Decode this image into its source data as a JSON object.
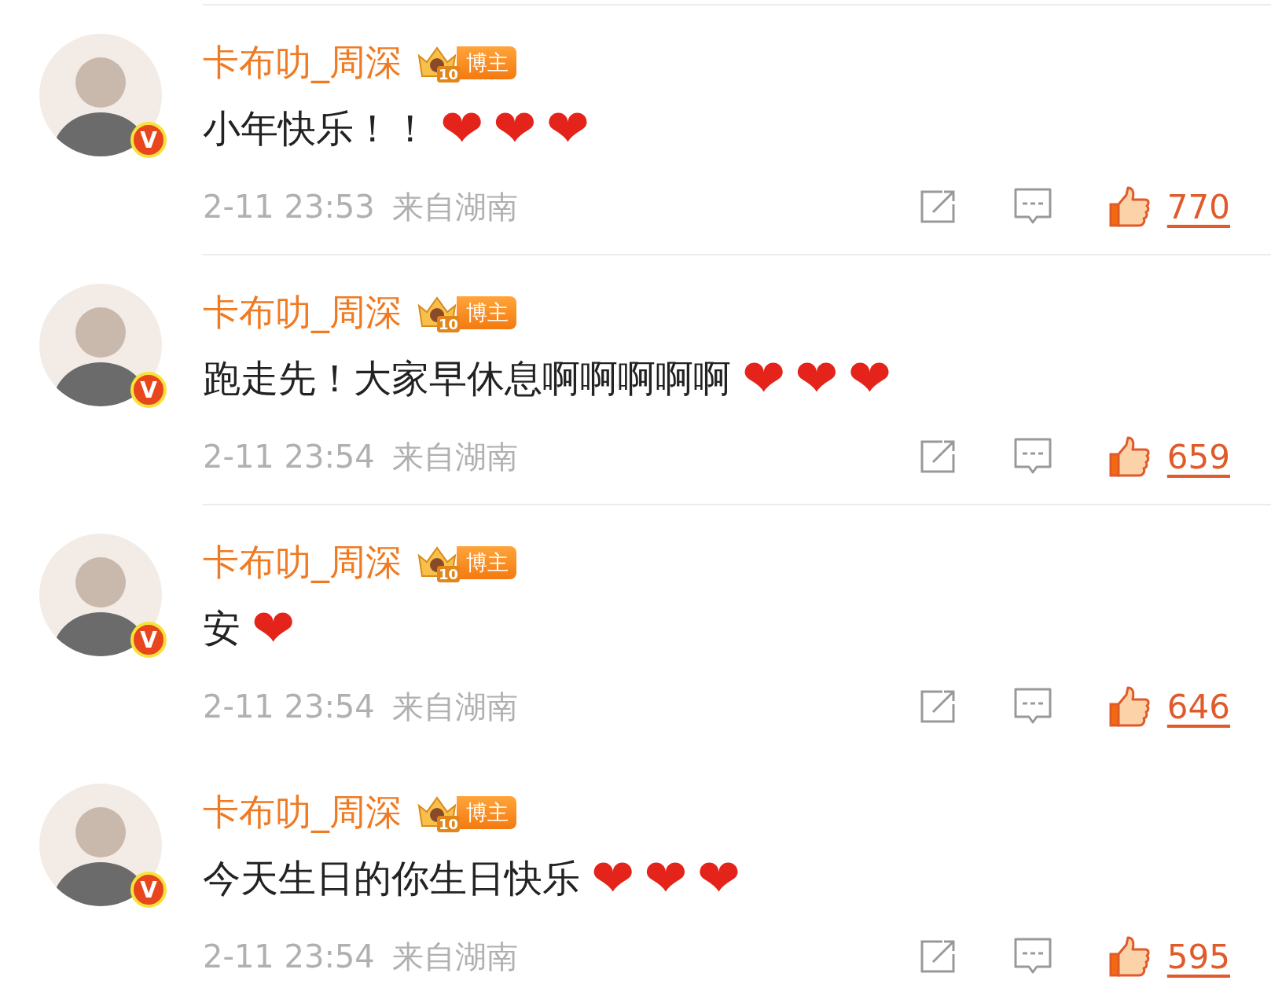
{
  "comments": [
    {
      "author": "卡布叻_周深",
      "badge": {
        "rank": "10",
        "label": "博主"
      },
      "verified_mark": "V",
      "text": "小年快乐！！",
      "emoji": [
        "❤",
        "❤",
        "❤"
      ],
      "time": "2-11 23:53",
      "location": "来自湖南",
      "liked": true,
      "likes": "770"
    },
    {
      "author": "卡布叻_周深",
      "badge": {
        "rank": "10",
        "label": "博主"
      },
      "verified_mark": "V",
      "text": "跑走先！大家早休息啊啊啊啊啊",
      "emoji": [
        "❤",
        "❤",
        "❤"
      ],
      "time": "2-11 23:54",
      "location": "来自湖南",
      "liked": true,
      "likes": "659"
    },
    {
      "author": "卡布叻_周深",
      "badge": {
        "rank": "10",
        "label": "博主"
      },
      "verified_mark": "V",
      "text": "安",
      "emoji": [
        "❤"
      ],
      "time": "2-11 23:54",
      "location": "来自湖南",
      "liked": true,
      "likes": "646"
    },
    {
      "author": "卡布叻_周深",
      "badge": {
        "rank": "10",
        "label": "博主"
      },
      "verified_mark": "V",
      "text": "今天生日的你生日快乐",
      "emoji": [
        "❤",
        "❤",
        "❤"
      ],
      "time": "2-11 23:54",
      "location": "来自湖南",
      "liked": true,
      "likes": "595"
    }
  ]
}
